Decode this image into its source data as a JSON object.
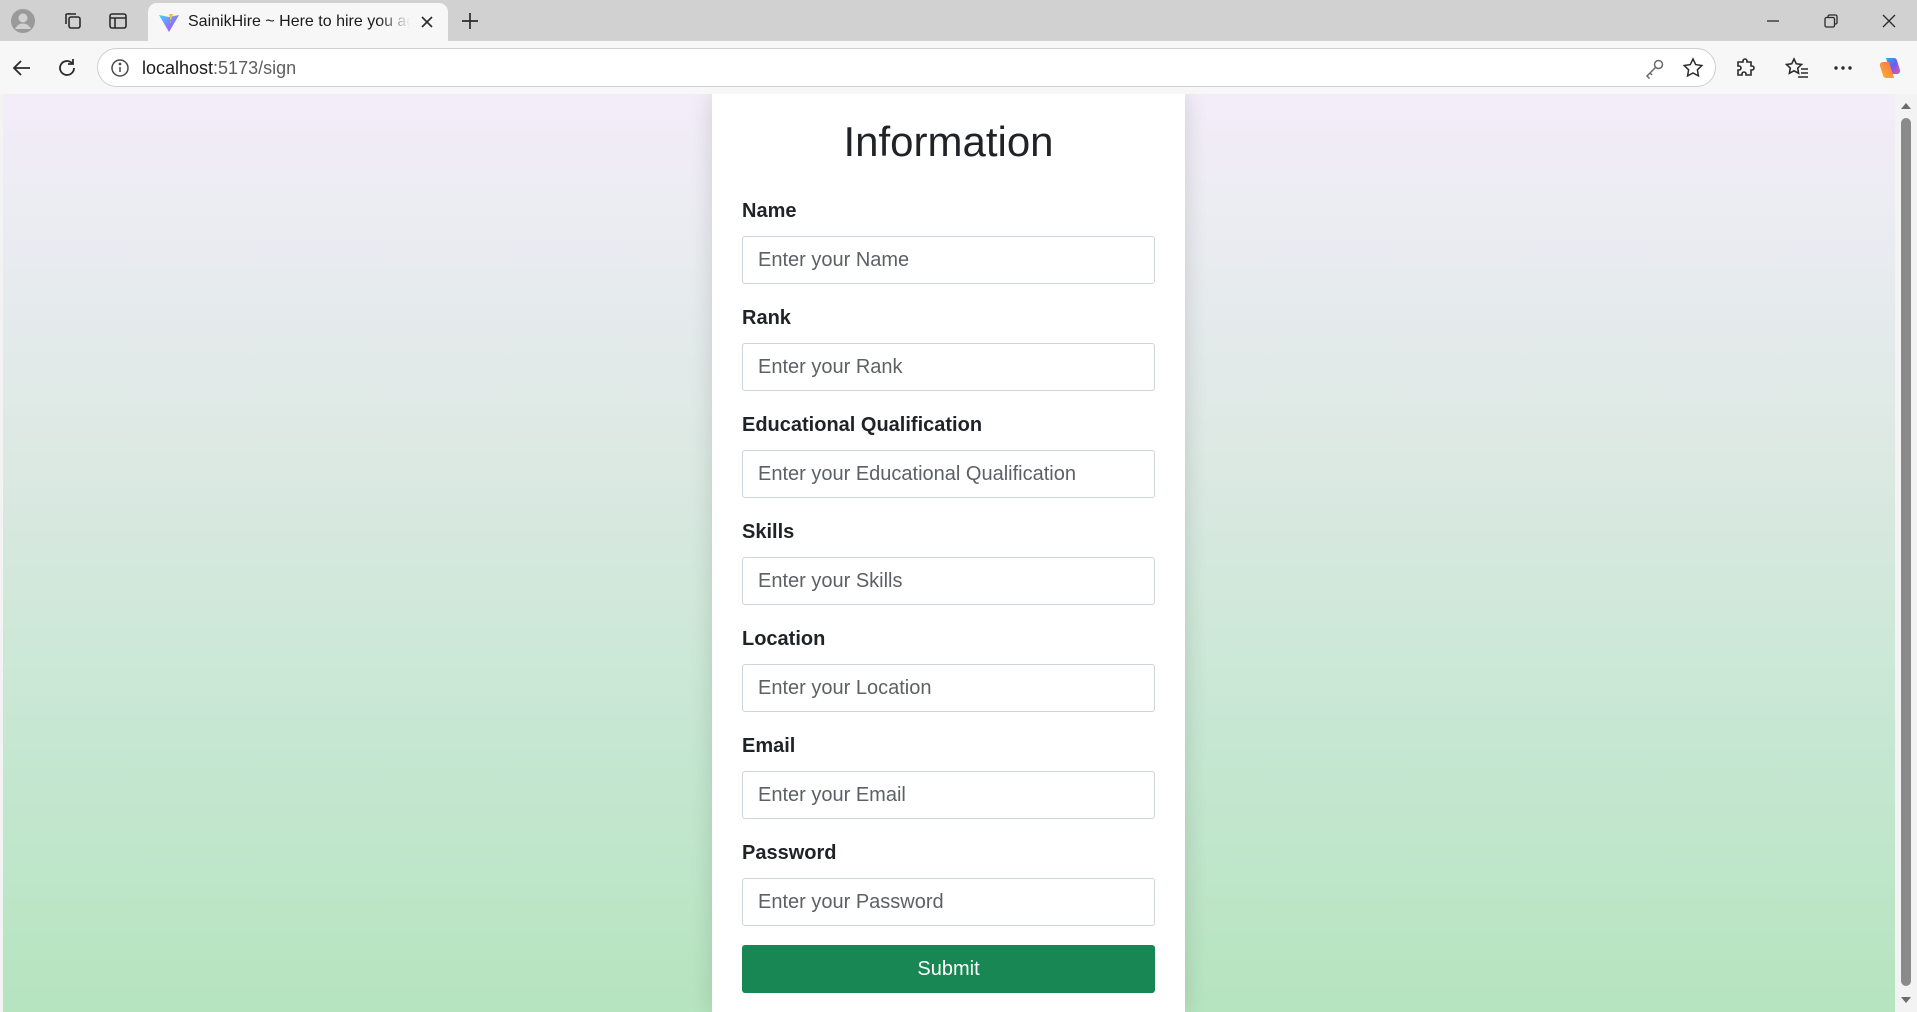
{
  "browser": {
    "tab_title": "SainikHire ~ Here to hire you again",
    "address": {
      "host": "localhost",
      "path": ":5173/sign"
    },
    "icons": {
      "profile": "profile-icon",
      "workspaces": "workspaces-icon",
      "vertical_tabs": "vertical-tabs-icon",
      "tab_logo": "vite-logo-icon",
      "close_tab": "close-icon",
      "new_tab": "plus-icon",
      "minimize": "minimize-icon",
      "restore": "restore-icon",
      "close_window": "close-icon",
      "back": "back-arrow-icon",
      "refresh": "refresh-icon",
      "site_info": "info-icon",
      "password_key": "key-icon",
      "favorite": "star-icon",
      "extensions": "extensions-icon",
      "favorites": "favorites-icon",
      "more": "more-icon",
      "copilot": "copilot-icon"
    }
  },
  "form": {
    "title": "Information",
    "fields": [
      {
        "label": "Name",
        "placeholder": "Enter your Name",
        "value": ""
      },
      {
        "label": "Rank",
        "placeholder": "Enter your Rank",
        "value": ""
      },
      {
        "label": "Educational Qualification",
        "placeholder": "Enter your Educational Qualification",
        "value": ""
      },
      {
        "label": "Skills",
        "placeholder": "Enter your Skills",
        "value": ""
      },
      {
        "label": "Location",
        "placeholder": "Enter your Location",
        "value": ""
      },
      {
        "label": "Email",
        "placeholder": "Enter your Email",
        "value": ""
      },
      {
        "label": "Password",
        "placeholder": "Enter your Password",
        "value": ""
      }
    ],
    "submit_label": "Submit"
  },
  "colors": {
    "submit_button": "#198754",
    "background_top": "#f3edf9",
    "background_bottom": "#b6e4bf",
    "card": "#ffffff"
  }
}
